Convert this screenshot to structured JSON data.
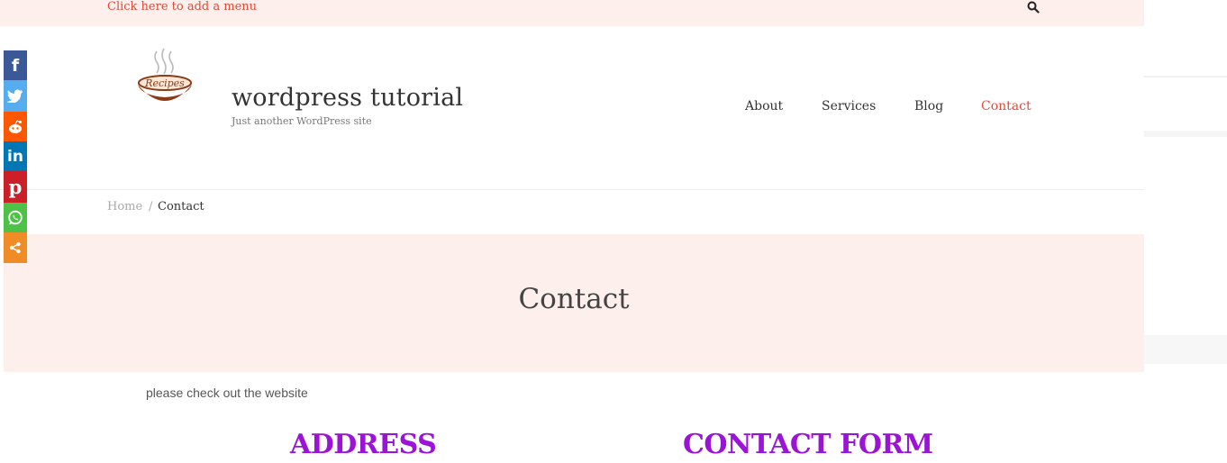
{
  "topbar": {
    "menu_link": "Click here to add a menu",
    "search_icon": "search-icon"
  },
  "site": {
    "title": "wordpress tutorial",
    "tagline": "Just another WordPress site",
    "logo_text": "Recipes"
  },
  "nav": [
    {
      "label": "About",
      "active": false
    },
    {
      "label": "Services",
      "active": false
    },
    {
      "label": "Blog",
      "active": false
    },
    {
      "label": "Contact",
      "active": true
    }
  ],
  "breadcrumb": {
    "home": "Home",
    "separator": "/",
    "current": "Contact"
  },
  "page": {
    "title": "Contact",
    "intro": "please check out the website"
  },
  "columns": {
    "left_heading": "ADDRESS",
    "right_heading": "CONTACT FORM"
  },
  "share": {
    "buttons": [
      {
        "network": "facebook",
        "icon": "facebook-icon",
        "color": "#3b5998"
      },
      {
        "network": "twitter",
        "icon": "twitter-icon",
        "color": "#55acee"
      },
      {
        "network": "reddit",
        "icon": "reddit-icon",
        "color": "#ff5700"
      },
      {
        "network": "linkedin",
        "icon": "linkedin-icon",
        "color": "#0077b5"
      },
      {
        "network": "pinterest",
        "icon": "pinterest-icon",
        "color": "#cb2027"
      },
      {
        "network": "whatsapp",
        "icon": "whatsapp-icon",
        "color": "#4dc247"
      },
      {
        "network": "more",
        "icon": "share-icon",
        "color": "#f08c25"
      }
    ]
  },
  "colors": {
    "accent": "#e04b3a",
    "heading": "#9a13d6",
    "band": "#fcefec"
  }
}
